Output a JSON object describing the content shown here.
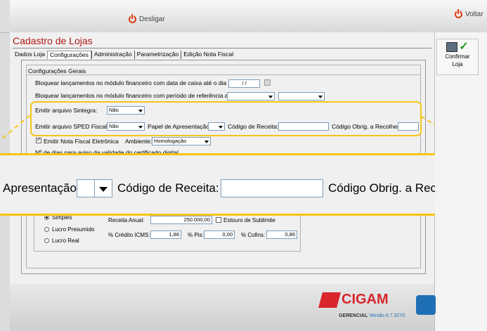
{
  "topbar": {
    "desligar_label": "Desligar",
    "voltar_label": "Voltar"
  },
  "window": {
    "title": "Cadastro de Lojas"
  },
  "tabs": [
    {
      "label": "Dados Loja"
    },
    {
      "label": "Configurações"
    },
    {
      "label": "Administração"
    },
    {
      "label": "Parametrização"
    },
    {
      "label": "Edição Nota Fiscal"
    }
  ],
  "group": {
    "title": "Configurações Gerais"
  },
  "fields": {
    "bloq_data_label": "Bloquear lançamentos no módulo financeiro com data de caixa até o dia",
    "bloq_data_value": "/ /",
    "bloq_periodo_label": "Bloquear lançamentos no módulo financeiro com período de referência até",
    "sintegra_label": "Emitir arquivo Sintegra:",
    "sintegra_value": "Não",
    "sped_label": "Emitir arquivo SPED Fiscal:",
    "sped_value": "Não",
    "papel_label": "Papel de Apresentação:",
    "cod_receita_label": "Código de Receita:",
    "cod_obrig_label": "Código Obrig. a Recolher:",
    "nfe_label": "Emitir Nota Fiscal Eletrônica",
    "ambiente_label": "Ambiente:",
    "ambiente_value": "Homologação",
    "dias_label": "Nº de dias para aviso da validade do certificado digital",
    "regime_simples": "Simples",
    "regime_presumido": "Lucro Presumido",
    "regime_real": "Lucro Real",
    "receita_anual_label": "Receita Anual:",
    "receita_anual_value": "250.000,00",
    "estouro_label": "Estouro de Sublimite",
    "credito_icms_label": "% Crédito ICMS:",
    "credito_icms_value": "1,86",
    "pis_label": "% Pis:",
    "pis_value": "0,00",
    "cofins_label": "% Cofins:",
    "cofins_value": "0,86"
  },
  "zoom": {
    "papel_label": "Apresentação:",
    "cod_receita_label": "Código de Receita:",
    "cod_obrig_label": "Código Obrig. a Recolher:"
  },
  "sidebar": {
    "confirm_label_1": "Confirmar",
    "confirm_label_2": "Loja"
  },
  "footer": {
    "brand": "CIGAM",
    "sub": "GERENCIAL",
    "version": "Versão 6.7.3270"
  },
  "colors": {
    "title": "#b01818",
    "highlight": "#f5c518",
    "brand": "#d8262c"
  }
}
